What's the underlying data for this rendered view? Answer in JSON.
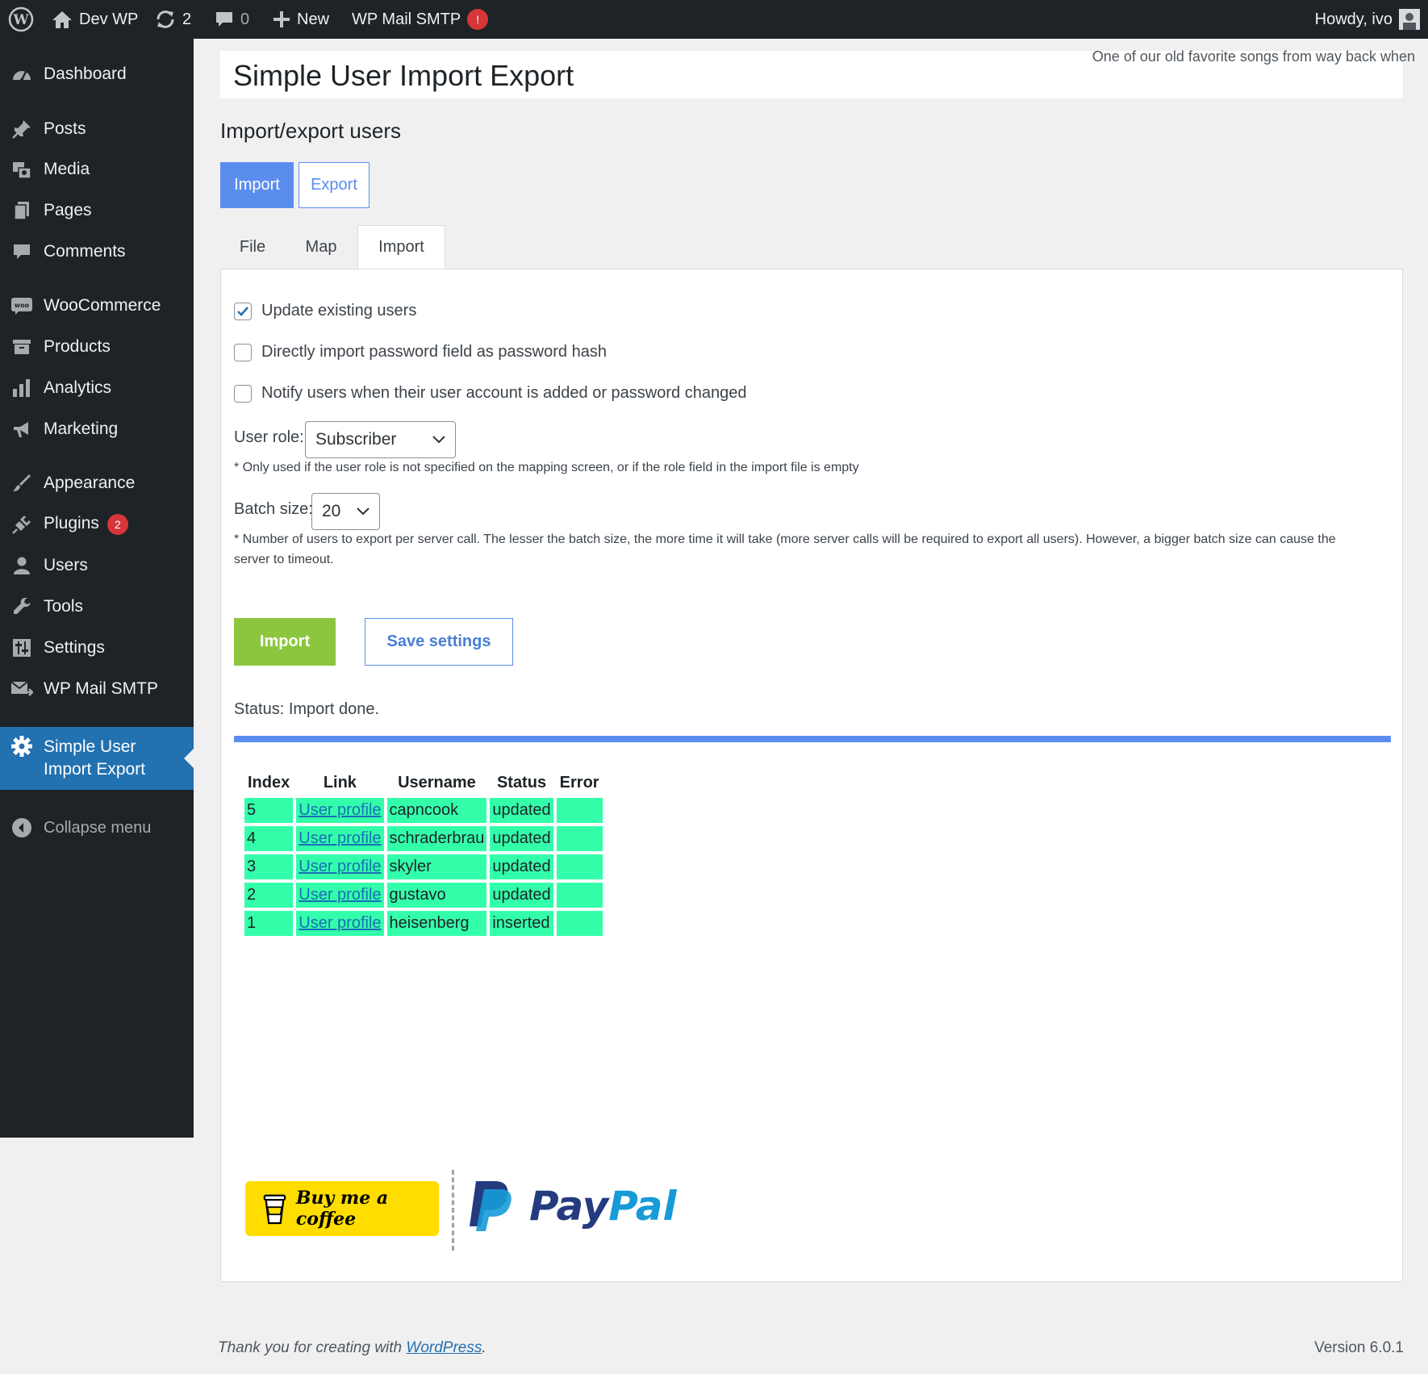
{
  "admin_bar": {
    "site_name": "Dev WP",
    "updates_count": "2",
    "comments_count": "0",
    "new_label": "New",
    "smtp_label": "WP Mail SMTP",
    "smtp_alert": "!",
    "howdy": "Howdy, ivo"
  },
  "sidebar": {
    "items": [
      {
        "label": "Dashboard",
        "icon": "dashboard-icon"
      },
      {
        "label": "Posts",
        "icon": "pin-icon"
      },
      {
        "label": "Media",
        "icon": "media-icon"
      },
      {
        "label": "Pages",
        "icon": "pages-icon"
      },
      {
        "label": "Comments",
        "icon": "comment-icon"
      },
      {
        "label": "WooCommerce",
        "icon": "woo-icon"
      },
      {
        "label": "Products",
        "icon": "archive-icon"
      },
      {
        "label": "Analytics",
        "icon": "bar-chart-icon"
      },
      {
        "label": "Marketing",
        "icon": "megaphone-icon"
      },
      {
        "label": "Appearance",
        "icon": "brush-icon"
      },
      {
        "label": "Plugins",
        "icon": "plug-icon",
        "badge": "2"
      },
      {
        "label": "Users",
        "icon": "user-icon"
      },
      {
        "label": "Tools",
        "icon": "wrench-icon"
      },
      {
        "label": "Settings",
        "icon": "sliders-icon"
      },
      {
        "label": "WP Mail SMTP",
        "icon": "mail-icon"
      },
      {
        "label": "Simple User Import Export",
        "icon": "gear-icon",
        "current": true
      }
    ],
    "collapse_label": "Collapse menu"
  },
  "header": {
    "title": "Simple User Import Export",
    "dolly": "One of our old favorite songs from way back when"
  },
  "main": {
    "subtitle": "Import/export users",
    "mode_tabs": [
      "Import",
      "Export"
    ],
    "step_tabs": [
      "File",
      "Map",
      "Import"
    ],
    "options": {
      "update_existing": {
        "label": "Update existing users",
        "checked": true
      },
      "password_hash": {
        "label": "Directly import password field as password hash",
        "checked": false
      },
      "notify_users": {
        "label": "Notify users when their user account is added or password changed",
        "checked": false
      }
    },
    "user_role": {
      "label": "User role:",
      "value": "Subscriber",
      "note": "* Only used if the user role is not specified on the mapping screen, or if the role field in the import file is empty"
    },
    "batch_size": {
      "label": "Batch size:",
      "value": "20",
      "note_line1": "* Number of users to export per server call. The lesser the batch size, the more time it will take (more server calls will be required to export all users). However, a bigger batch size can cause the",
      "note_line2": "server to timeout."
    },
    "import_button": "Import",
    "save_button": "Save settings",
    "status": "Status: Import done.",
    "progress": 1.0,
    "results": {
      "headers": [
        "Index",
        "Link",
        "Username",
        "Status",
        "Error"
      ],
      "rows": [
        {
          "index": "5",
          "link": "User profile",
          "username": "capncook",
          "status": "updated",
          "error": ""
        },
        {
          "index": "4",
          "link": "User profile",
          "username": "schraderbrau",
          "status": "updated",
          "error": ""
        },
        {
          "index": "3",
          "link": "User profile",
          "username": "skyler",
          "status": "updated",
          "error": ""
        },
        {
          "index": "2",
          "link": "User profile",
          "username": "gustavo",
          "status": "updated",
          "error": ""
        },
        {
          "index": "1",
          "link": "User profile",
          "username": "heisenberg",
          "status": "inserted",
          "error": ""
        }
      ]
    },
    "donate": {
      "bmc_label": "Buy me a coffee",
      "paypal_pay": "Pay",
      "paypal_pal": "Pal"
    }
  },
  "footer": {
    "thanks_prefix": "Thank you for creating with ",
    "thanks_link": "WordPress",
    "thanks_suffix": ".",
    "version": "Version 6.0.1"
  },
  "colors": {
    "admin_dark": "#1d2327",
    "accent_blue": "#2271b1",
    "tab_blue": "#5b8def",
    "import_green": "#8cc63f",
    "row_green": "#33ffaa",
    "badge_red": "#d63638"
  }
}
